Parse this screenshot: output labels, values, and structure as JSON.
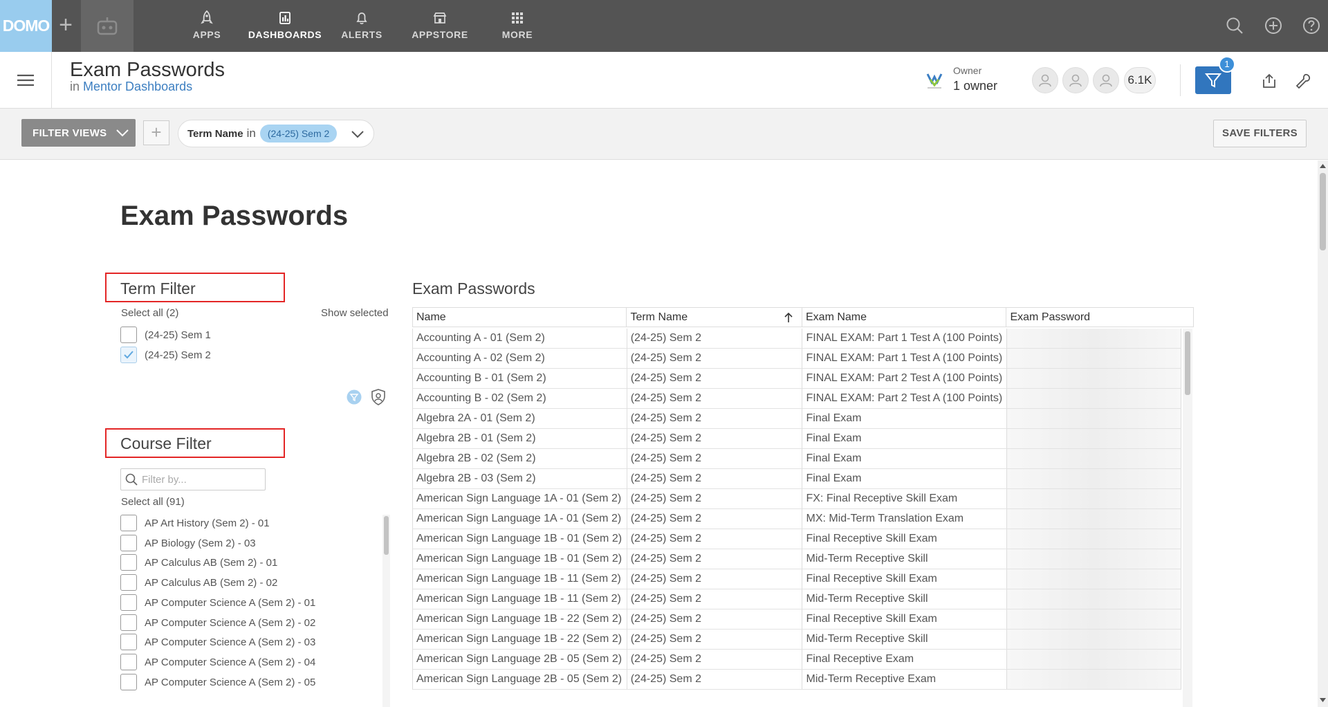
{
  "nav": {
    "logo": "DOMO",
    "items": [
      {
        "label": "APPS",
        "icon": "rocket-icon"
      },
      {
        "label": "DASHBOARDS",
        "icon": "dashboard-icon"
      },
      {
        "label": "ALERTS",
        "icon": "bell-icon"
      },
      {
        "label": "APPSTORE",
        "icon": "store-icon"
      },
      {
        "label": "MORE",
        "icon": "grid-icon"
      }
    ],
    "active": "DASHBOARDS"
  },
  "header": {
    "title": "Exam Passwords",
    "in_label": "in",
    "parent_link": "Mentor Dashboards",
    "owner_label": "Owner",
    "owner_value": "1 owner",
    "viewer_count": "6.1K",
    "filter_count": "1"
  },
  "filter_bar": {
    "filter_views_label": "FILTER VIEWS",
    "add_label": "+",
    "pill": {
      "field": "Term Name",
      "operator": "in",
      "value": "(24-25) Sem 2"
    },
    "save_label": "SAVE FILTERS"
  },
  "dashboard": {
    "title": "Exam Passwords"
  },
  "term_filter": {
    "title": "Term Filter",
    "select_all": "Select all (2)",
    "show_selected": "Show selected",
    "options": [
      {
        "label": "(24-25) Sem 1",
        "checked": false
      },
      {
        "label": "(24-25) Sem 2",
        "checked": true
      }
    ]
  },
  "course_filter": {
    "title": "Course Filter",
    "search_placeholder": "Filter by...",
    "select_all": "Select all (91)",
    "options": [
      "AP Art History (Sem 2) - 01",
      "AP Biology (Sem 2) - 03",
      "AP Calculus AB (Sem 2) - 01",
      "AP Calculus AB (Sem 2) - 02",
      "AP Computer Science A (Sem 2) - 01",
      "AP Computer Science A (Sem 2) - 02",
      "AP Computer Science A (Sem 2) - 03",
      "AP Computer Science A (Sem 2) - 04",
      "AP Computer Science A (Sem 2) - 05"
    ]
  },
  "table": {
    "title": "Exam Passwords",
    "columns": [
      "Name",
      "Term Name",
      "Exam Name",
      "Exam Password"
    ],
    "sorted_column": "Term Name",
    "rows": [
      [
        "Accounting A - 01 (Sem 2)",
        "(24-25) Sem 2",
        "FINAL EXAM: Part 1 Test A (100 Points)",
        ""
      ],
      [
        "Accounting A - 02 (Sem 2)",
        "(24-25) Sem 2",
        "FINAL EXAM: Part 1 Test A (100 Points)",
        ""
      ],
      [
        "Accounting B - 01 (Sem 2)",
        "(24-25) Sem 2",
        "FINAL EXAM: Part 2 Test A (100 Points)",
        ""
      ],
      [
        "Accounting B - 02 (Sem 2)",
        "(24-25) Sem 2",
        "FINAL EXAM: Part 2 Test A (100 Points)",
        ""
      ],
      [
        "Algebra 2A - 01 (Sem 2)",
        "(24-25) Sem 2",
        "Final Exam",
        ""
      ],
      [
        "Algebra 2B - 01 (Sem 2)",
        "(24-25) Sem 2",
        "Final Exam",
        ""
      ],
      [
        "Algebra 2B - 02 (Sem 2)",
        "(24-25) Sem 2",
        "Final Exam",
        ""
      ],
      [
        "Algebra 2B - 03 (Sem 2)",
        "(24-25) Sem 2",
        "Final Exam",
        ""
      ],
      [
        "American Sign Language 1A - 01 (Sem 2)",
        "(24-25) Sem 2",
        "FX: Final Receptive Skill Exam",
        ""
      ],
      [
        "American Sign Language 1A - 01 (Sem 2)",
        "(24-25) Sem 2",
        "MX: Mid-Term Translation Exam",
        ""
      ],
      [
        "American Sign Language 1B - 01 (Sem 2)",
        "(24-25) Sem 2",
        "Final Receptive Skill Exam",
        ""
      ],
      [
        "American Sign Language 1B - 01 (Sem 2)",
        "(24-25) Sem 2",
        "Mid-Term Receptive Skill",
        ""
      ],
      [
        "American Sign Language 1B - 11 (Sem 2)",
        "(24-25) Sem 2",
        "Final Receptive Skill Exam",
        ""
      ],
      [
        "American Sign Language 1B - 11 (Sem 2)",
        "(24-25) Sem 2",
        "Mid-Term Receptive Skill",
        ""
      ],
      [
        "American Sign Language 1B - 22 (Sem 2)",
        "(24-25) Sem 2",
        "Final Receptive Skill Exam",
        ""
      ],
      [
        "American Sign Language 1B - 22 (Sem 2)",
        "(24-25) Sem 2",
        "Mid-Term Receptive Skill",
        ""
      ],
      [
        "American Sign Language 2B - 05 (Sem 2)",
        "(24-25) Sem 2",
        "Final Receptive Exam",
        ""
      ],
      [
        "American Sign Language 2B - 05 (Sem 2)",
        "(24-25) Sem 2",
        "Mid-Term Receptive Exam",
        ""
      ]
    ]
  },
  "colors": {
    "nav_bg": "#545454",
    "logo_bg": "#99ccee",
    "accent": "#3176be",
    "highlight_box": "#e32626",
    "pill_value_bg": "#a9d4f2"
  }
}
